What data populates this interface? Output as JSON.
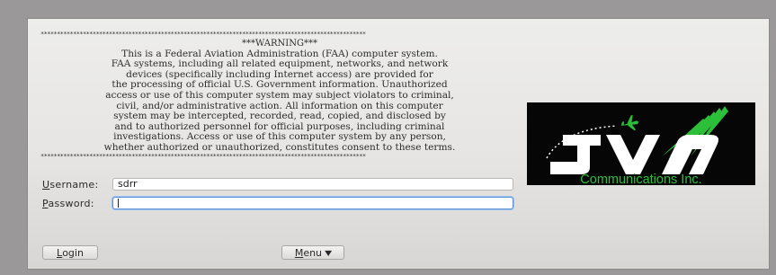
{
  "banner": {
    "stars": "****************************************************************************************************",
    "title": "***WARNING***",
    "lines": [
      "This is a Federal Aviation Administration (FAA) computer system.",
      "FAA systems, including all related equipment, networks, and network",
      "devices (specifically including Internet access) are provided for",
      "the processing of official U.S. Government information. Unauthorized",
      "access or use of this computer system may subject violators to criminal,",
      "civil, and/or administrative action. All information on this computer",
      "system may be intercepted, recorded, read, copied, and disclosed by",
      "and to authorized personnel for official purposes, including criminal",
      "investigations. Access or use of this computer system by any person,",
      "whether authorized or unauthorized, constitutes consent to these terms."
    ]
  },
  "logo": {
    "letters": "JVN",
    "tagline": "Communications Inc.",
    "colors": {
      "background": "#060606",
      "letters": "#ffffff",
      "accent": "#2cc03a"
    },
    "icon": "airplane-icon"
  },
  "form": {
    "username": {
      "label_first": "U",
      "label_rest": "sername:",
      "value": "sdrr"
    },
    "password": {
      "label_first": "P",
      "label_rest": "assword:",
      "value": ""
    }
  },
  "buttons": {
    "login_first": "L",
    "login_rest": "ogin",
    "menu_first": "M",
    "menu_rest": "enu"
  }
}
